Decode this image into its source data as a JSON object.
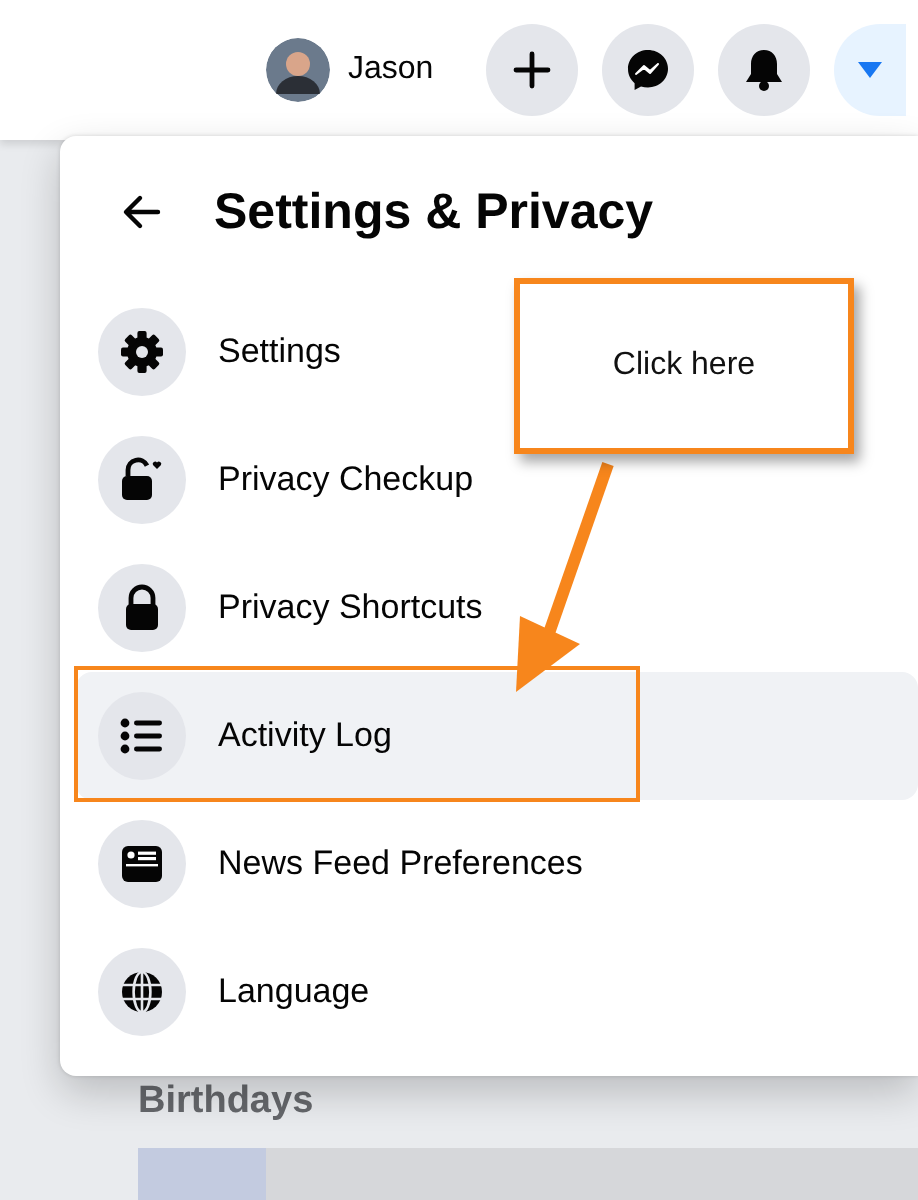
{
  "top_bar": {
    "user_name": "Jason",
    "buttons": [
      {
        "kind": "create",
        "selected": false
      },
      {
        "kind": "messenger",
        "selected": false
      },
      {
        "kind": "notifications",
        "selected": false
      },
      {
        "kind": "account",
        "selected": true
      }
    ]
  },
  "menu": {
    "title": "Settings & Privacy",
    "items": [
      {
        "kind": "gear",
        "label": "Settings",
        "selected": false
      },
      {
        "kind": "checkup",
        "label": "Privacy Checkup",
        "selected": false
      },
      {
        "kind": "lock",
        "label": "Privacy Shortcuts",
        "selected": false
      },
      {
        "kind": "list",
        "label": "Activity Log",
        "selected": true
      },
      {
        "kind": "feed",
        "label": "News Feed Preferences",
        "selected": false
      },
      {
        "kind": "globe",
        "label": "Language",
        "selected": false
      }
    ]
  },
  "annotation": {
    "callout": "Click here"
  },
  "feed": {
    "section_title": "Birthdays"
  }
}
